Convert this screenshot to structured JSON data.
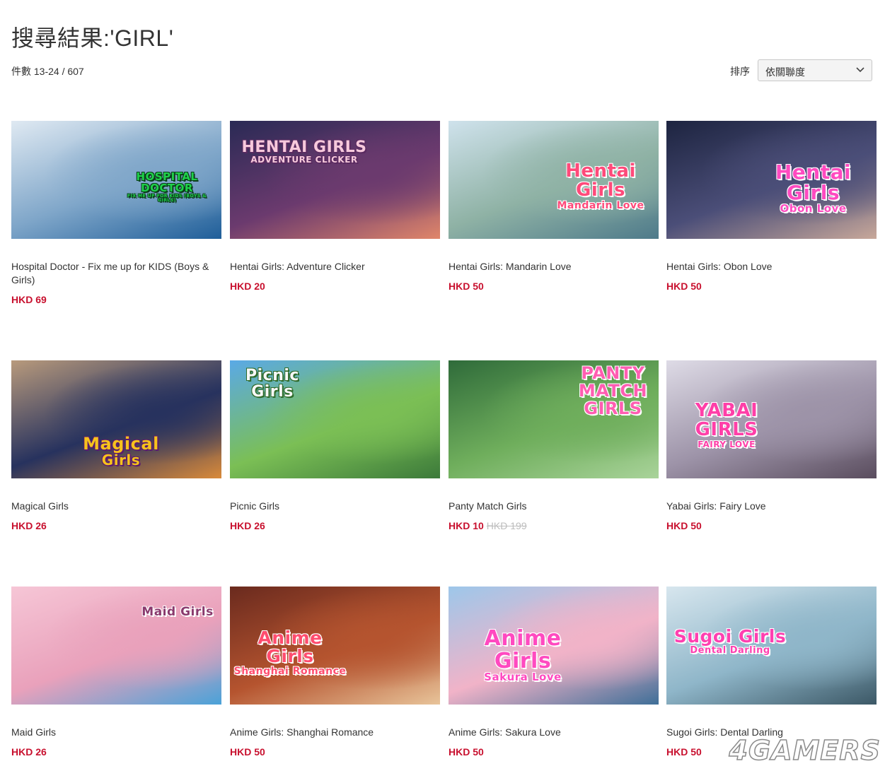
{
  "page_title": "搜尋結果:'GIRL'",
  "result_count": "件數 13-24 / 607",
  "sort": {
    "label": "排序",
    "selected": "依關聯度"
  },
  "accent_price_color": "#c8102e",
  "products": [
    {
      "name": "Hospital Doctor - Fix me up for KIDS (Boys & Girls)",
      "price": "HKD 69",
      "art_title": "HOSPITAL DOCTOR",
      "art_subtitle": "FIX ME UP FOR KIDS (BOYS & GIRLS)",
      "colors": [
        "#dfe9f2",
        "#7fa6c9",
        "#1f5e99"
      ]
    },
    {
      "name": "Hentai Girls: Adventure Clicker",
      "price": "HKD 20",
      "art_title": "HENTAI GIRLS",
      "art_subtitle": "ADVENTURE CLICKER",
      "colors": [
        "#2a2a55",
        "#6b3a6e",
        "#e0866a"
      ]
    },
    {
      "name": "Hentai Girls: Mandarin Love",
      "price": "HKD 50",
      "art_title": "Hentai Girls",
      "art_subtitle": "Mandarin Love",
      "colors": [
        "#cfe2ec",
        "#8fb2a5",
        "#4e7a8a"
      ]
    },
    {
      "name": "Hentai Girls: Obon Love",
      "price": "HKD 50",
      "art_title": "Hentai Girls",
      "art_subtitle": "Obon Love",
      "colors": [
        "#1d2440",
        "#4b4e78",
        "#c8a89a"
      ]
    },
    {
      "name": "Magical Girls",
      "price": "HKD 26",
      "art_title": "Magical",
      "art_subtitle": "Girls",
      "colors": [
        "#b89a7c",
        "#27325e",
        "#d98a3a"
      ]
    },
    {
      "name": "Picnic Girls",
      "price": "HKD 26",
      "art_title": "Picnic",
      "art_subtitle": "Girls",
      "colors": [
        "#5aa9e6",
        "#7bbf55",
        "#3c7a3a"
      ]
    },
    {
      "name": "Panty Match Girls",
      "price": "HKD 10",
      "original_price": "HKD 199",
      "art_title": "PANTY MATCH",
      "art_subtitle": "GIRLS",
      "colors": [
        "#2f6b3a",
        "#6fae5c",
        "#a9d39a"
      ]
    },
    {
      "name": "Yabai Girls: Fairy Love",
      "price": "HKD 50",
      "art_title": "YABAI GIRLS",
      "art_subtitle": "FAIRY LOVE",
      "colors": [
        "#dedbe6",
        "#9d93a8",
        "#5a4d5e"
      ]
    },
    {
      "name": "Maid Girls",
      "price": "HKD 26",
      "art_title": "Maid Girls",
      "art_subtitle": "",
      "colors": [
        "#f6c6d6",
        "#e9a1bb",
        "#4aa2d8"
      ]
    },
    {
      "name": "Anime Girls: Shanghai Romance",
      "price": "HKD 50",
      "art_title": "Anime Girls",
      "art_subtitle": "Shanghai Romance",
      "colors": [
        "#6a2a1e",
        "#b5542f",
        "#e8c49a"
      ]
    },
    {
      "name": "Anime Girls: Sakura Love",
      "price": "HKD 50",
      "art_title": "Anime Girls",
      "art_subtitle": "Sakura Love",
      "colors": [
        "#9dc7ea",
        "#f1b3c8",
        "#3f6f98"
      ]
    },
    {
      "name": "Sugoi Girls: Dental Darling",
      "price": "HKD 50",
      "art_title": "Sugoi Girls",
      "art_subtitle": "Dental Darling",
      "colors": [
        "#d7e6ee",
        "#8fb6c9",
        "#3c5866"
      ]
    }
  ],
  "watermark": "4GAMERS"
}
